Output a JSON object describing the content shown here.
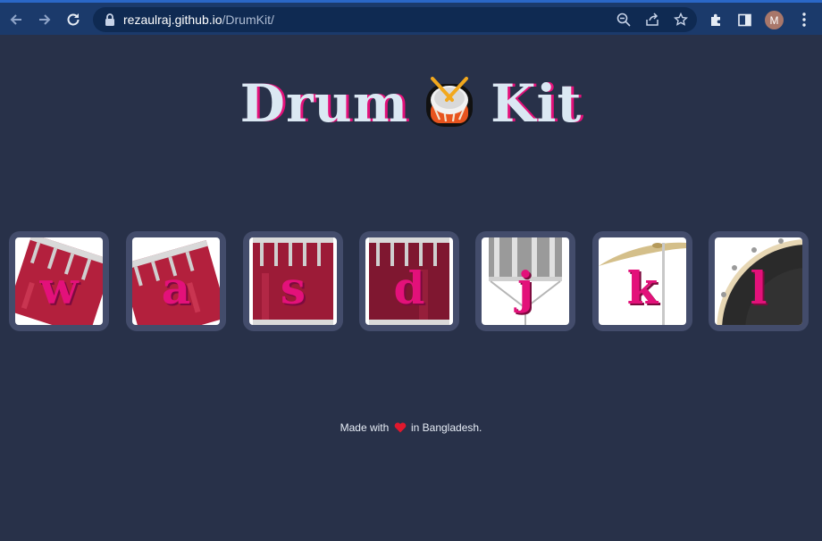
{
  "browser": {
    "url_host": "rezaulraj.github.io",
    "url_path": "/DrumKit/",
    "avatar_letter": "M"
  },
  "page": {
    "title_left": "Drum",
    "title_right": "Kit",
    "title_emoji": "drum-emoji"
  },
  "drums": [
    {
      "key": "w",
      "instrument": "tom-1"
    },
    {
      "key": "a",
      "instrument": "tom-2"
    },
    {
      "key": "s",
      "instrument": "tom-3"
    },
    {
      "key": "d",
      "instrument": "tom-4"
    },
    {
      "key": "j",
      "instrument": "snare"
    },
    {
      "key": "k",
      "instrument": "crash"
    },
    {
      "key": "l",
      "instrument": "kick-bass"
    }
  ],
  "footer": {
    "before": "Made with",
    "after": "in Bangladesh."
  },
  "colors": {
    "background": "#283149",
    "button": "#434c6b",
    "accent": "#e3117a",
    "title": "#dbe8f3"
  }
}
